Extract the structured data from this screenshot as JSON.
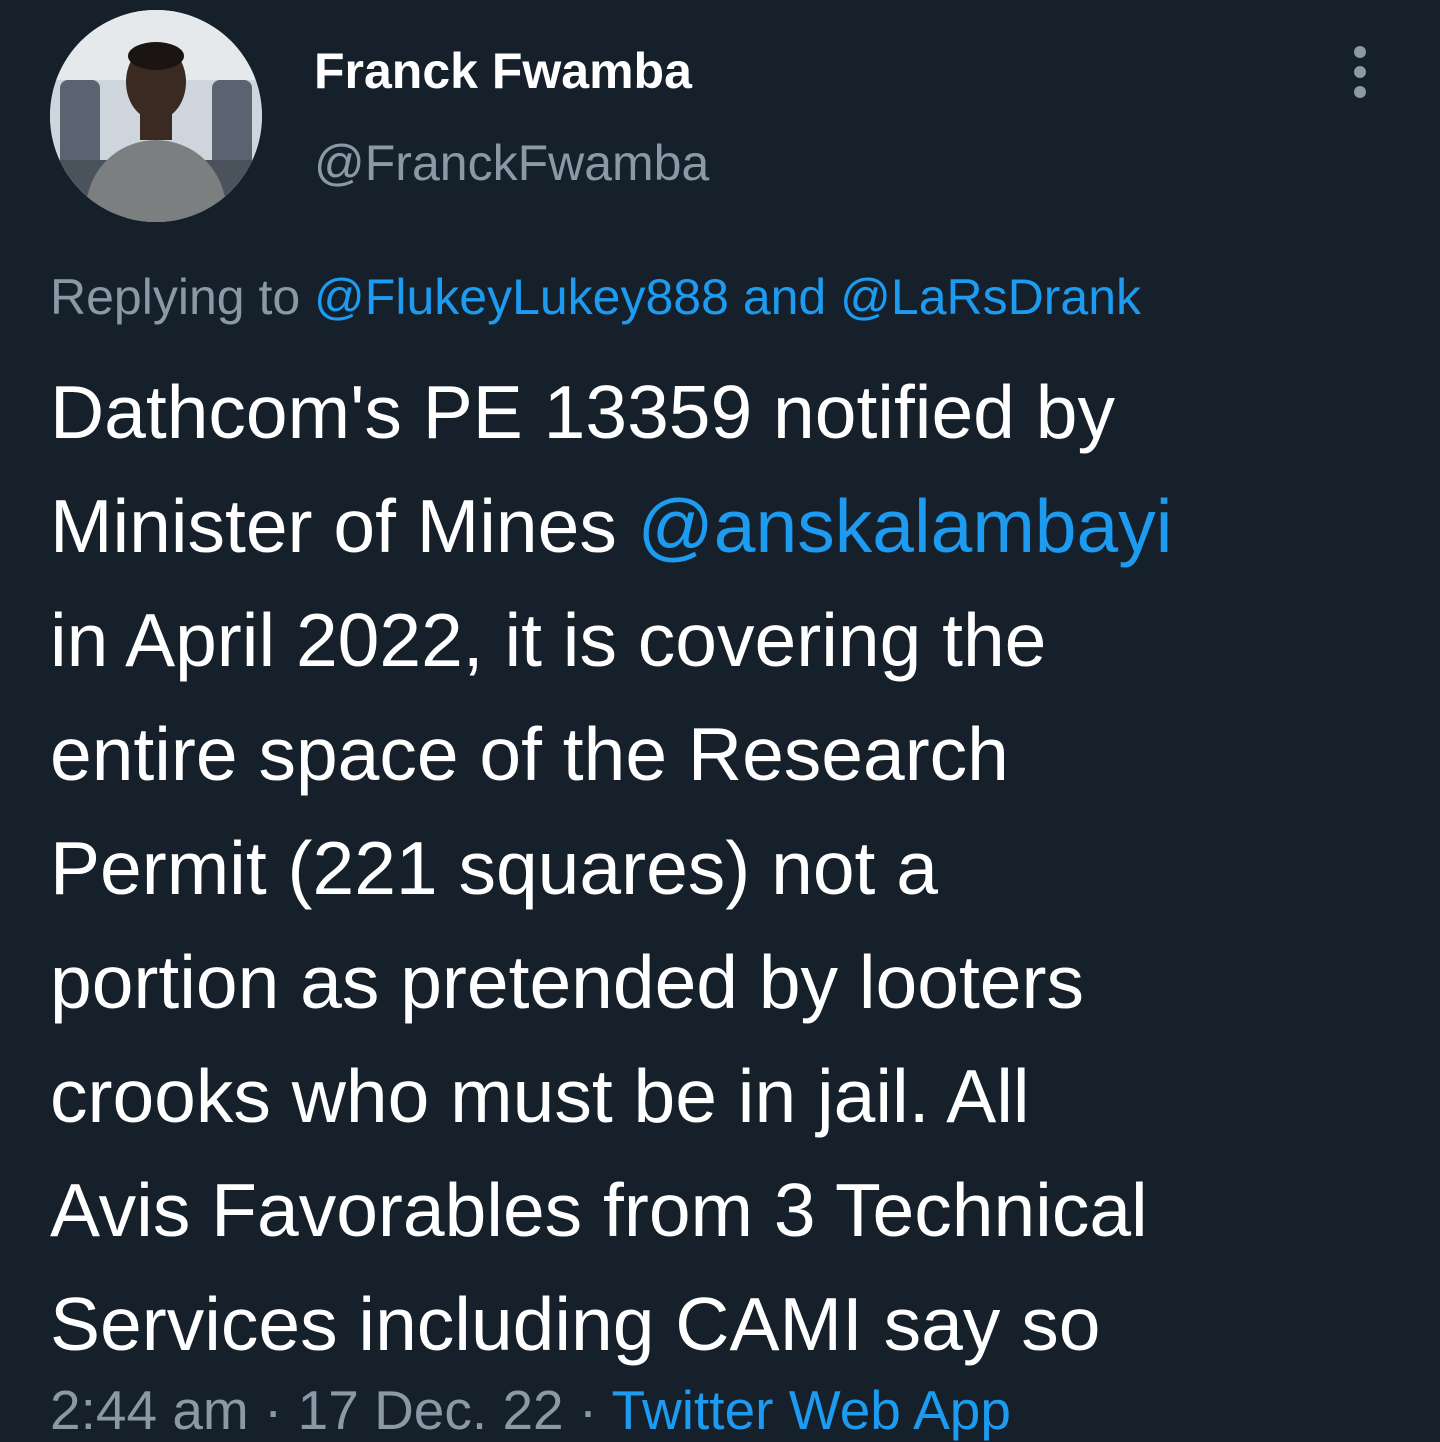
{
  "author": {
    "display_name": "Franck Fwamba",
    "handle": "@FranckFwamba"
  },
  "menu": {
    "icon": "more-vertical-icon"
  },
  "reply": {
    "prefix": "Replying to ",
    "users": [
      "@FlukeyLukey888",
      "@LaRsDrank"
    ],
    "joiner": " and "
  },
  "tweet": {
    "line1": "Dathcom's PE 13359 notified by",
    "line2_text": "Minister of Mines ",
    "line2_mention": "@anskalambayi",
    "line3": "in April 2022, it is covering the",
    "line4": "entire space of the Research",
    "line5": "Permit (221 squares) not a",
    "line6": "portion as pretended by looters",
    "line7": "crooks who must be in jail. All",
    "line8": "Avis Favorables from 3 Technical",
    "line9": "Services including CAMI say so"
  },
  "meta": {
    "time": "2:44 am",
    "separator": " · ",
    "date": "17 Dec. 22",
    "source": "Twitter Web App"
  },
  "colors": {
    "background": "#16202b",
    "link": "#1d9bf0",
    "muted": "#8b98a5",
    "text": "#ffffff"
  }
}
